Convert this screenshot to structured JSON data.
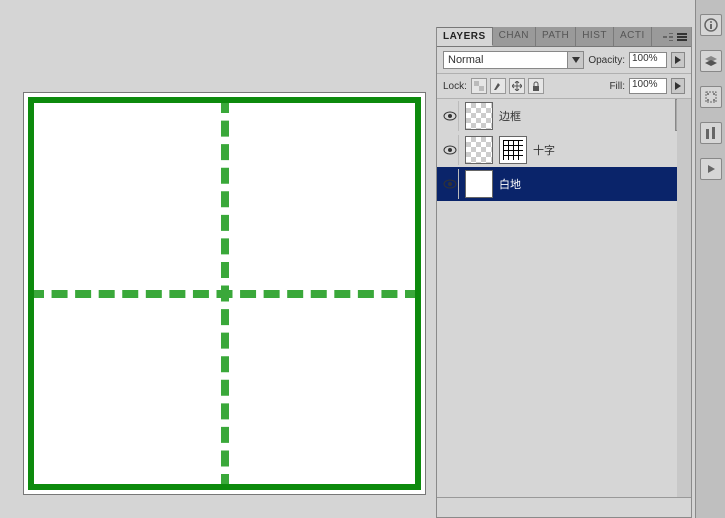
{
  "panel": {
    "tabs": [
      "LAYERS",
      "CHAN",
      "PATH",
      "HIST",
      "ACTI"
    ],
    "active_tab": "LAYERS",
    "blend_mode": "Normal",
    "opacity_label": "Opacity:",
    "opacity_value": "100%",
    "lock_label": "Lock:",
    "fill_label": "Fill:",
    "fill_value": "100%"
  },
  "layers": [
    {
      "name": "边框",
      "has_mask": false,
      "selected": false,
      "transparent": true
    },
    {
      "name": "十字",
      "has_mask": true,
      "selected": false,
      "transparent": true
    },
    {
      "name": "白地",
      "has_mask": false,
      "selected": true,
      "transparent": false
    }
  ],
  "dock": {
    "icons": [
      "info-icon",
      "layers-icon",
      "tool-a-icon",
      "tool-b-icon",
      "play-icon"
    ]
  }
}
